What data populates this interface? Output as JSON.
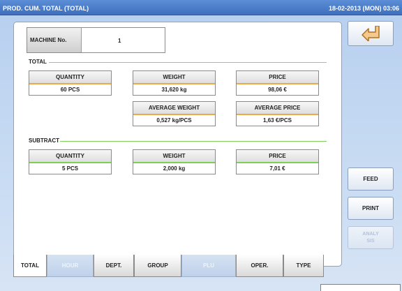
{
  "titlebar": {
    "title": "PROD. CUM. TOTAL (TOTAL)",
    "datetime": "18-02-2013 (MON) 03:06"
  },
  "machine": {
    "label": "MACHINE No.",
    "value": "1"
  },
  "total": {
    "label": "TOTAL",
    "quantity": {
      "label": "QUANTITY",
      "value": "60 PCS"
    },
    "weight": {
      "label": "WEIGHT",
      "value": "31,620 kg"
    },
    "price": {
      "label": "PRICE",
      "value": "98,06 €"
    },
    "average_weight": {
      "label": "AVERAGE WEIGHT",
      "value": "0,527 kg/PCS"
    },
    "average_price": {
      "label": "AVERAGE PRICE",
      "value": "1,63 €/PCS"
    }
  },
  "subtract": {
    "label": "SUBTRACT",
    "quantity": {
      "label": "QUANTITY",
      "value": "5 PCS"
    },
    "weight": {
      "label": "WEIGHT",
      "value": "2,000 kg"
    },
    "price": {
      "label": "PRICE",
      "value": "7,01 €"
    }
  },
  "side_buttons": {
    "back_icon": "return-arrow-icon",
    "feed": "FEED",
    "print": "PRINT",
    "analysis": "ANALY\nSIS"
  },
  "tabs": [
    "TOTAL",
    "HOUR",
    "DEPT.",
    "GROUP",
    "PLU",
    "OPER.",
    "TYPE"
  ],
  "colors": {
    "total_accent": "#f0a845",
    "subtract_accent": "#7fce5a",
    "titlebar": "#4a7dcc",
    "background": "#c3d7f1"
  }
}
